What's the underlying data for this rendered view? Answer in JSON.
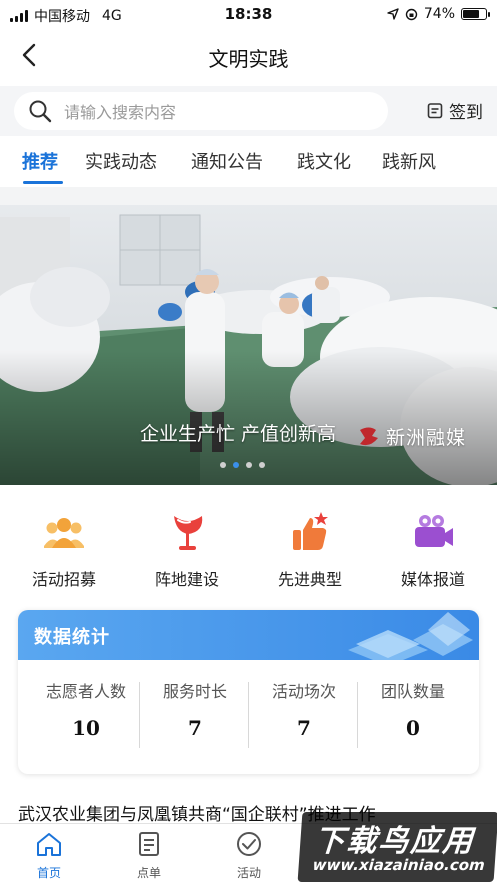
{
  "status_bar": {
    "carrier": "中国移动",
    "network": "4G",
    "time": "18:38",
    "battery": "74%",
    "battery_level": 0.74
  },
  "nav": {
    "title": "文明实践"
  },
  "search": {
    "placeholder": "请输入搜索内容",
    "checkin_label": "签到"
  },
  "tabs": [
    {
      "label": "推荐",
      "active": true
    },
    {
      "label": "实践动态"
    },
    {
      "label": "通知公告"
    },
    {
      "label": "践文化"
    },
    {
      "label": "践新风"
    }
  ],
  "banner": {
    "caption": "企业生产忙 产值创新高",
    "watermark": "新洲融媒",
    "slide_count": 4,
    "active_slide": 1
  },
  "quick_actions": [
    {
      "label": "活动招募",
      "icon": "people-icon",
      "color": "#f2a33a"
    },
    {
      "label": "阵地建设",
      "icon": "flag-icon",
      "color": "#e9413c"
    },
    {
      "label": "先进典型",
      "icon": "thumbs-up-icon",
      "color": "#f07a3a"
    },
    {
      "label": "媒体报道",
      "icon": "video-camera-icon",
      "color": "#9b4fd0"
    }
  ],
  "stats": {
    "title": "数据统计",
    "items": [
      {
        "label": "志愿者人数",
        "value": "10"
      },
      {
        "label": "服务时长",
        "value": "7"
      },
      {
        "label": "活动场次",
        "value": "7"
      },
      {
        "label": "团队数量",
        "value": "0"
      }
    ]
  },
  "article": {
    "title": "武汉农业集团与凤凰镇共商“国企联村”推进工作"
  },
  "bottom_tabs": [
    {
      "label": "首页",
      "icon": "home-icon",
      "active": true
    },
    {
      "label": "点单",
      "icon": "order-icon"
    },
    {
      "label": "活动",
      "icon": "check-circle-icon"
    }
  ],
  "site_watermark": {
    "text": "下载鸟应用",
    "url": "www.xiazainiao.com"
  },
  "colors": {
    "accent": "#1a73d9",
    "stats_header": "#3a8ae6"
  }
}
